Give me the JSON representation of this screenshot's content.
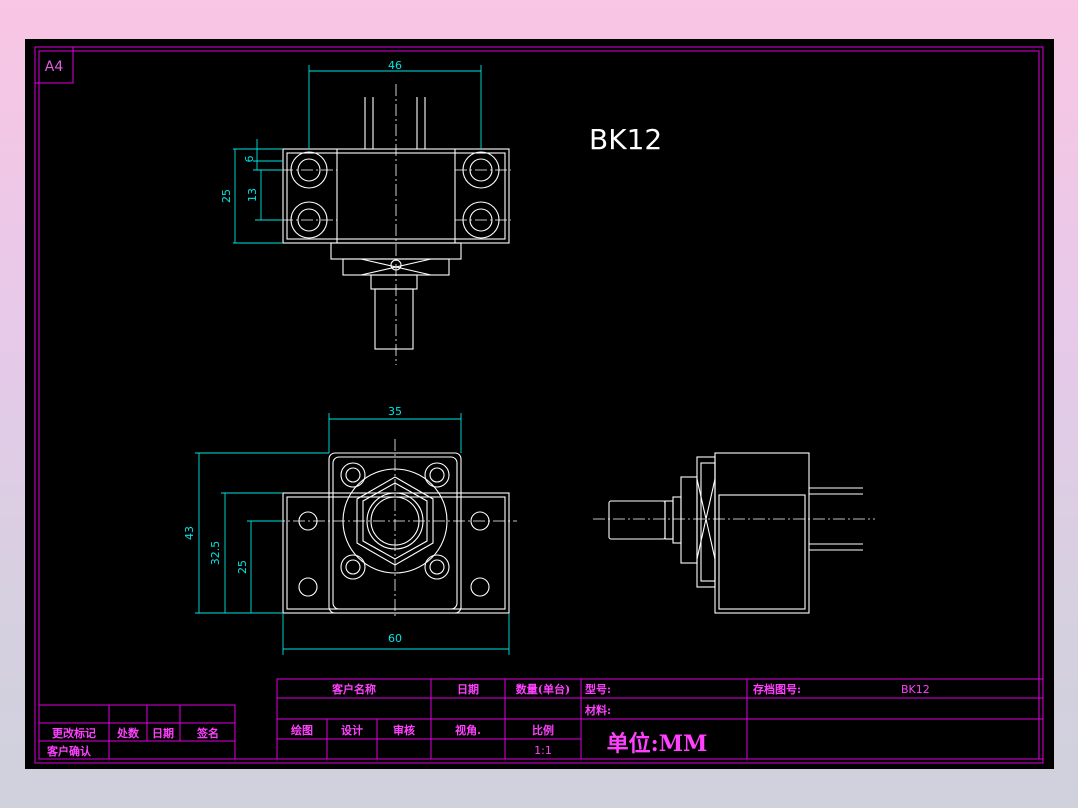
{
  "sheet_size": "A4",
  "part_title": "BK12",
  "dimensions": {
    "top_width": "46",
    "top_pitch_small": "6",
    "top_pitch_mid": "13",
    "top_height": "25",
    "front_inner_width": "35",
    "front_width": "60",
    "front_height": "43",
    "front_center_height": "32.5",
    "front_lower": "25"
  },
  "title_block": {
    "customer_name": "客户名称",
    "date": "日期",
    "quantity": "数量(单台)",
    "model": "型号:",
    "archive_no": "存档图号:",
    "archive_value": "BK12",
    "material": "材料:",
    "drawing": "绘图",
    "design": "设计",
    "review": "审核",
    "view_angle": "视角.",
    "scale_label": "比例",
    "scale_value": "1:1",
    "unit": "单位:MM"
  },
  "revision_block": {
    "change_mark": "更改标记",
    "count": "处数",
    "date": "日期",
    "signature": "签名",
    "customer_confirm": "客户确认"
  },
  "colors": {
    "border": "#e000e0",
    "dimension": "#00e5e5",
    "geometry": "#ffffff",
    "label": "#ff40ff"
  }
}
